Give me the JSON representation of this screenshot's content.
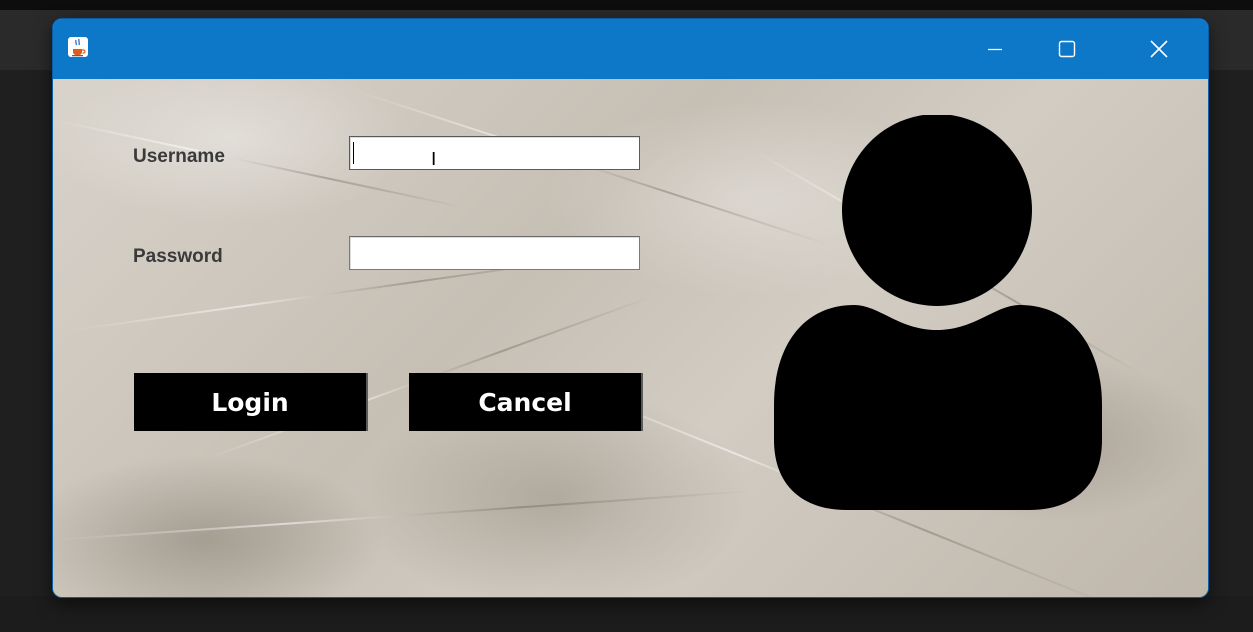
{
  "window": {
    "title": "",
    "app_icon": "java-coffee-cup-icon",
    "controls": {
      "minimize_icon": "minimize-icon",
      "maximize_icon": "maximize-icon",
      "close_icon": "close-icon"
    },
    "titlebar_color": "#0e78c8"
  },
  "form": {
    "username_label": "Username",
    "username_value": "",
    "password_label": "Password",
    "password_value": "",
    "login_label": "Login",
    "cancel_label": "Cancel",
    "button_color": "#000000",
    "button_text_color": "#ffffff"
  },
  "avatar": {
    "icon": "user-silhouette-icon",
    "color": "#000000"
  },
  "background": {
    "texture": "crumpled-paper"
  }
}
